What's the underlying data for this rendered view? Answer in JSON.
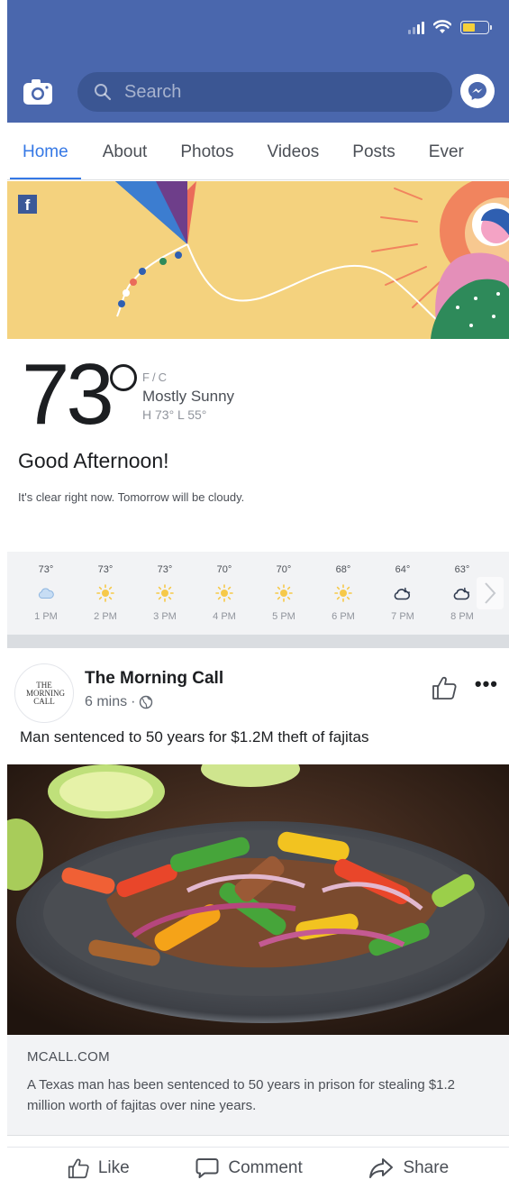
{
  "search": {
    "placeholder": "Search"
  },
  "tabs": [
    {
      "label": "Home",
      "active": true
    },
    {
      "label": "About",
      "active": false
    },
    {
      "label": "Photos",
      "active": false
    },
    {
      "label": "Videos",
      "active": false
    },
    {
      "label": "Posts",
      "active": false
    },
    {
      "label": "Ever",
      "active": false
    }
  ],
  "weather": {
    "temperature": "73",
    "unit_f": "F",
    "unit_sep": "/",
    "unit_c": "C",
    "condition": "Mostly Sunny",
    "high_low": "H 73° L 55°",
    "greeting": "Good Afternoon!",
    "message": "It's clear right now. Tomorrow will be cloudy.",
    "hourly": [
      {
        "temp": "73°",
        "icon": "cloud-icon",
        "time": "1 PM"
      },
      {
        "temp": "73°",
        "icon": "sun-icon",
        "time": "2 PM"
      },
      {
        "temp": "73°",
        "icon": "sun-icon",
        "time": "3 PM"
      },
      {
        "temp": "70°",
        "icon": "sun-icon",
        "time": "4 PM"
      },
      {
        "temp": "70°",
        "icon": "sun-icon",
        "time": "5 PM"
      },
      {
        "temp": "68°",
        "icon": "sun-icon",
        "time": "6 PM"
      },
      {
        "temp": "64°",
        "icon": "moon-cloud-icon",
        "time": "7 PM"
      },
      {
        "temp": "63°",
        "icon": "moon-cloud-icon",
        "time": "8 PM"
      }
    ]
  },
  "post": {
    "avatar_text": "THE MORNING CALL",
    "page_name": "The Morning Call",
    "time": "6 mins",
    "dot": "·",
    "headline": "Man sentenced to 50 years for $1.2M theft of fajitas",
    "link_domain": "MCALL.COM",
    "link_description": "A Texas man has been sentenced to 50 years in prison for stealing $1.2 million worth of fajitas over nine years.",
    "actions": {
      "like": "Like",
      "comment": "Comment",
      "share": "Share"
    }
  },
  "colors": {
    "header": "#4a67ad",
    "search_bg": "#3b5693",
    "accent": "#3578e5",
    "banner": "#f4d27e"
  }
}
